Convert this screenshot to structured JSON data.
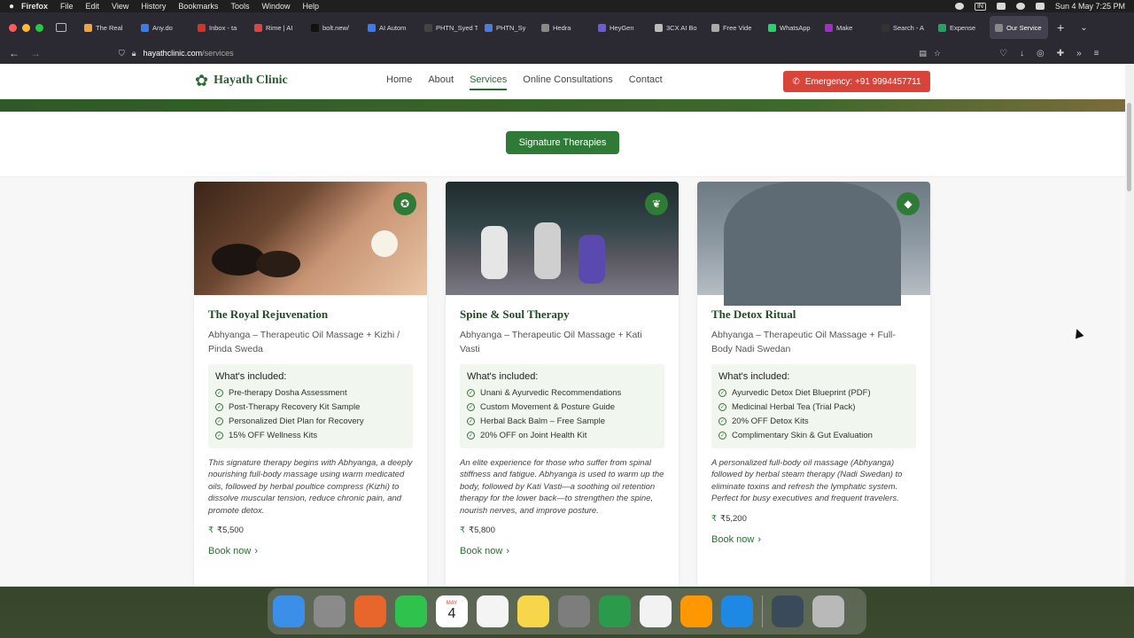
{
  "menubar": {
    "app": "Firefox",
    "items": [
      "File",
      "Edit",
      "View",
      "History",
      "Bookmarks",
      "Tools",
      "Window",
      "Help"
    ],
    "input_source": "IN",
    "clock": "Sun 4 May  7:25 PM"
  },
  "tabs": [
    {
      "label": "The Real",
      "color": "#f2a33a"
    },
    {
      "label": "Any.do",
      "color": "#3b7bf0"
    },
    {
      "label": "Inbox - ta",
      "color": "#d93025"
    },
    {
      "label": "Rime | AI",
      "color": "#d44"
    },
    {
      "label": "bolt.new/",
      "color": "#111111"
    },
    {
      "label": "AI Autom",
      "color": "#3b7bf0"
    },
    {
      "label": "PHTN_Syed T",
      "color": "#444444"
    },
    {
      "label": "PHTN_Sy",
      "color": "#4a7bd9"
    },
    {
      "label": "Hedra",
      "color": "#888888"
    },
    {
      "label": "HeyGen",
      "color": "#6b5ae0"
    },
    {
      "label": "3CX AI Bo",
      "color": "#bbbbbb"
    },
    {
      "label": "Free Vide",
      "color": "#aaaaaa"
    },
    {
      "label": "WhatsApp",
      "color": "#25d366"
    },
    {
      "label": "Make",
      "color": "#a22cc9"
    },
    {
      "label": "Search - A",
      "color": "#333333"
    },
    {
      "label": "Expense",
      "color": "#21a366"
    },
    {
      "label": "Our Service",
      "color": "#888888",
      "active": true
    }
  ],
  "url": {
    "host": "hayathclinic.com",
    "path": "/services"
  },
  "site": {
    "logo_glyph": "✿",
    "logo_text": "Hayath Clinic",
    "nav": [
      {
        "label": "Home"
      },
      {
        "label": "About"
      },
      {
        "label": "Services",
        "current": true
      },
      {
        "label": "Online Consultations"
      },
      {
        "label": "Contact"
      }
    ],
    "emergency_label": "Emergency: +91 9994457711",
    "section_pill": "Signature Therapies"
  },
  "cards": [
    {
      "title": "The Royal Rejuvenation",
      "subtitle": "Abhyanga – Therapeutic Oil Massage + Kizhi / Pinda Sweda",
      "badge_icon": "award-icon",
      "badge_glyph": "✪",
      "included_heading": "What's included:",
      "included": [
        "Pre-therapy Dosha Assessment",
        "Post-Therapy Recovery Kit Sample",
        "Personalized Diet Plan for Recovery",
        "15% OFF Wellness Kits"
      ],
      "description": "This signature therapy begins with Abhyanga, a deeply nourishing full-body massage using warm medicated oils, followed by herbal poultice compress (Kizhi) to dissolve muscular tension, reduce chronic pain, and promote detox.",
      "price": "₹5,500",
      "cta": "Book now"
    },
    {
      "title": "Spine & Soul Therapy",
      "subtitle": "Abhyanga – Therapeutic Oil Massage + Kati Vasti",
      "badge_icon": "leaf-icon",
      "badge_glyph": "❦",
      "included_heading": "What's included:",
      "included": [
        "Unani & Ayurvedic Recommendations",
        "Custom Movement & Posture Guide",
        "Herbal Back Balm – Free Sample",
        "20% OFF on Joint Health Kit"
      ],
      "description": "An elite experience for those who suffer from spinal stiffness and fatigue. Abhyanga is used to warm up the body, followed by Kati Vasti—a soothing oil retention therapy for the lower back—to strengthen the spine, nourish nerves, and improve posture.",
      "price": "₹5,800",
      "cta": "Book now"
    },
    {
      "title": "The Detox Ritual",
      "subtitle": "Abhyanga – Therapeutic Oil Massage + Full-Body Nadi Swedan",
      "badge_icon": "droplet-icon",
      "badge_glyph": "◆",
      "included_heading": "What's included:",
      "included": [
        "Ayurvedic Detox Diet Blueprint (PDF)",
        "Medicinal Herbal Tea (Trial Pack)",
        "20% OFF Detox Kits",
        "Complimentary Skin & Gut Evaluation"
      ],
      "description": "A personalized full-body oil massage (Abhyanga) followed by herbal steam therapy (Nadi Swedan) to eliminate toxins and refresh the lymphatic system. Perfect for busy executives and frequent travelers.",
      "price": "₹5,200",
      "cta": "Book now"
    }
  ],
  "dock": {
    "calendar_month": "MAY",
    "calendar_day": "4",
    "apps": [
      {
        "name": "finder-icon",
        "color": "#3b8fe8"
      },
      {
        "name": "launchpad-icon",
        "color": "#8a8a8a"
      },
      {
        "name": "firefox-icon",
        "color": "#e8662b"
      },
      {
        "name": "facetime-icon",
        "color": "#2fc34e"
      },
      {
        "name": "calendar-icon",
        "color": "#ffffff"
      },
      {
        "name": "reminders-icon",
        "color": "#f4f4f4"
      },
      {
        "name": "notes-icon",
        "color": "#f7d64a"
      },
      {
        "name": "settings-icon",
        "color": "#7d7d7d"
      },
      {
        "name": "chrome-icon",
        "color": "#2b9a4a"
      },
      {
        "name": "freeform-icon",
        "color": "#f2f2f2"
      },
      {
        "name": "sublime-icon",
        "color": "#ff9800"
      },
      {
        "name": "proxyman-icon",
        "color": "#1e88e5"
      },
      {
        "name": "downloads-stack-icon",
        "color": "#3a4a5a"
      },
      {
        "name": "trash-icon",
        "color": "#b9b9b9"
      }
    ]
  }
}
